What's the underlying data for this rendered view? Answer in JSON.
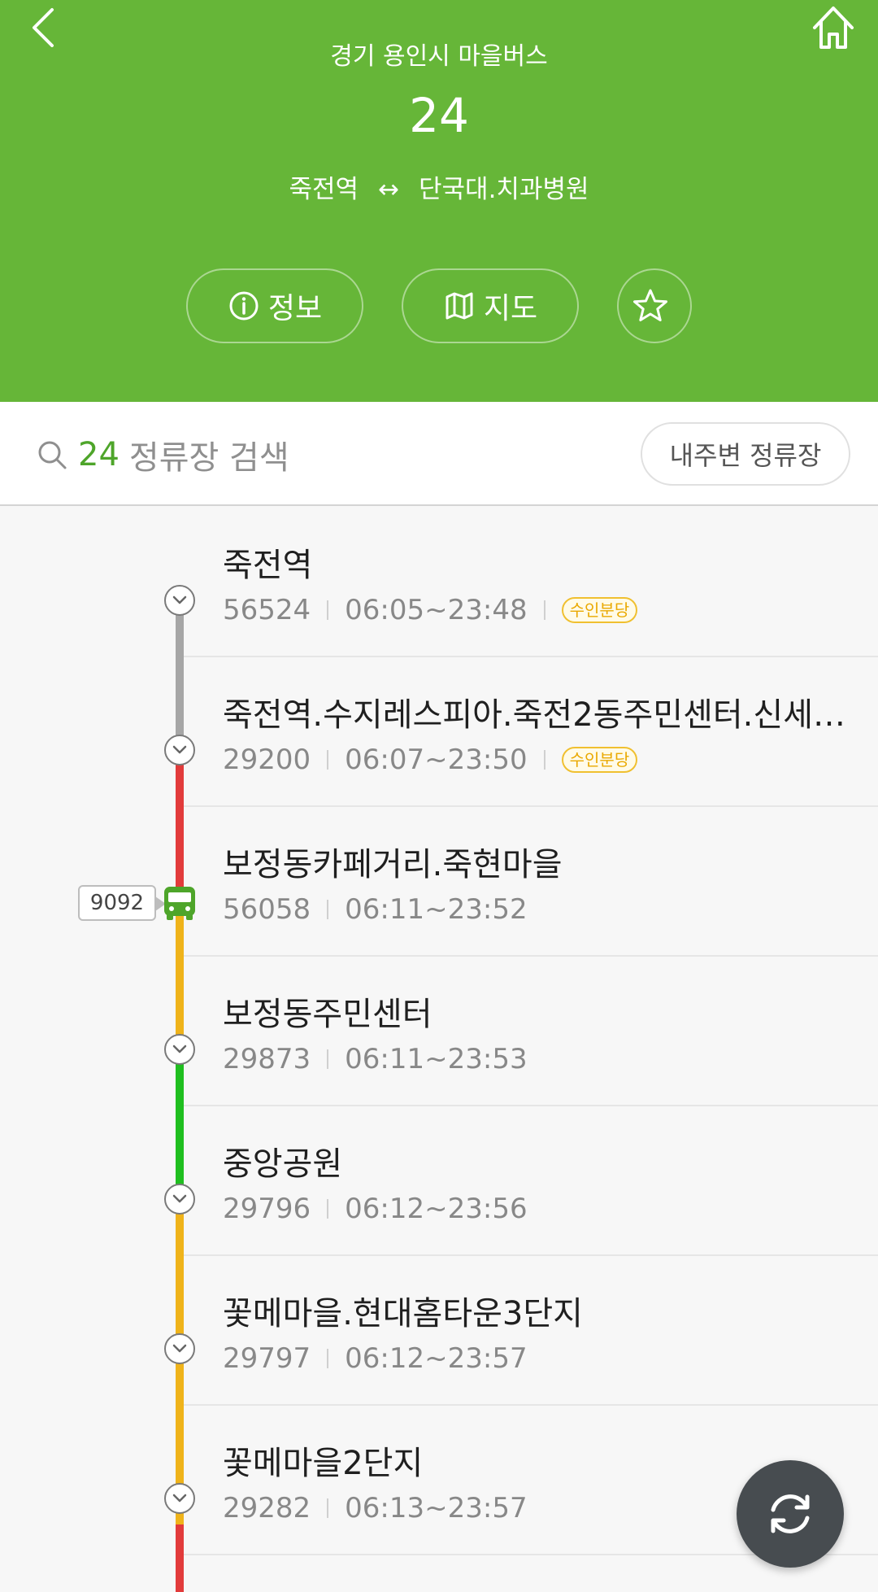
{
  "header": {
    "subtitle": "경기 용인시 마을버스",
    "route_number": "24",
    "origin": "죽전역",
    "route_arrow": "↔",
    "destination": "단국대.치과병원",
    "info_label": "정보",
    "map_label": "지도"
  },
  "search": {
    "route_number": "24",
    "placeholder": "정류장 검색",
    "nearby_label": "내주변 정류장"
  },
  "bus_marker": {
    "label": "9092"
  },
  "stops": [
    {
      "name": "죽전역",
      "id": "56524",
      "hours": "06:05~23:48",
      "badge": "수인분당"
    },
    {
      "name": "죽전역.수지레스피아.죽전2동주민센터.신세…",
      "id": "29200",
      "hours": "06:07~23:50",
      "badge": "수인분당"
    },
    {
      "name": "보정동카페거리.죽현마을",
      "id": "56058",
      "hours": "06:11~23:52"
    },
    {
      "name": "보정동주민센터",
      "id": "29873",
      "hours": "06:11~23:53"
    },
    {
      "name": "중앙공원",
      "id": "29796",
      "hours": "06:12~23:56"
    },
    {
      "name": "꽃메마을.현대홈타운3단지",
      "id": "29797",
      "hours": "06:12~23:57"
    },
    {
      "name": "꽃메마을2단지",
      "id": "29282",
      "hours": "06:13~23:57"
    }
  ],
  "colors": {
    "header_bg": "#66b638",
    "traffic_none": "#a6a6a6",
    "traffic_jam": "#e23b3b",
    "traffic_slow": "#efb31a",
    "traffic_smooth": "#1fbf1f"
  }
}
